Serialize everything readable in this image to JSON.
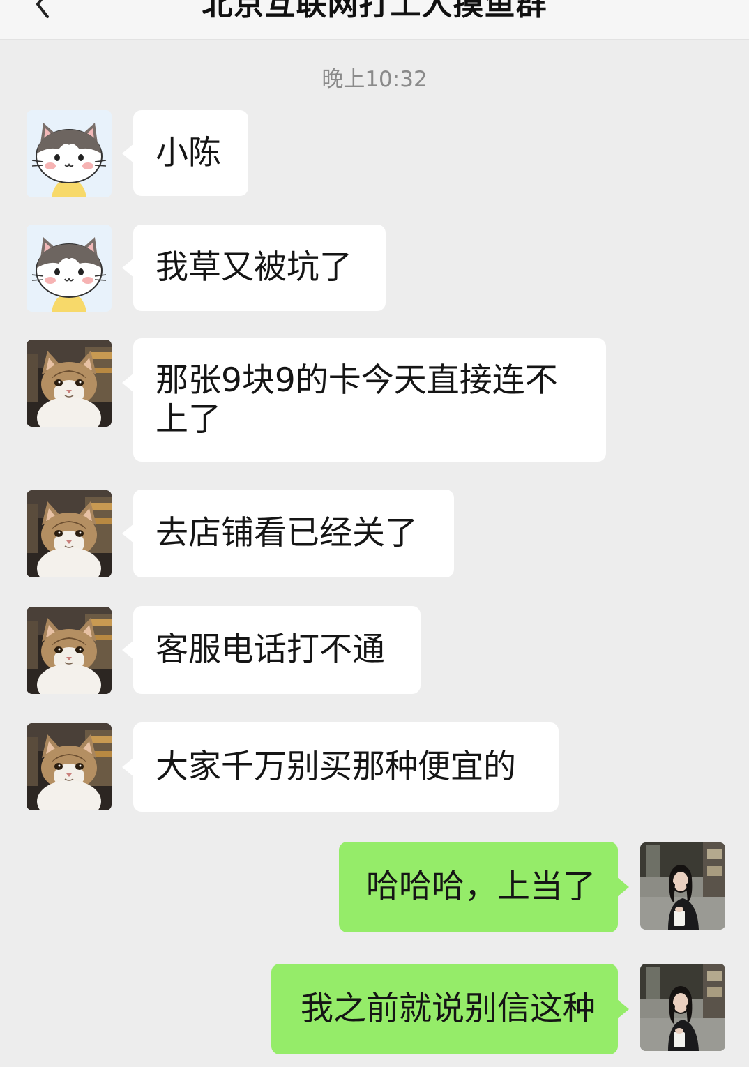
{
  "header": {
    "title": "北京互联网打工人摸鱼群",
    "back_icon": "chevron-left-icon"
  },
  "timestamp": "晚上10:32",
  "messages": [
    {
      "side": "left",
      "avatar": "cartoon-cat-avatar",
      "text": "小陈"
    },
    {
      "side": "left",
      "avatar": "cartoon-cat-avatar",
      "text": "我草又被坑了"
    },
    {
      "side": "left",
      "avatar": "photo-cat-avatar",
      "text": "那张9块9的卡今天直接连不上了"
    },
    {
      "side": "left",
      "avatar": "photo-cat-avatar",
      "text": "去店铺看已经关了"
    },
    {
      "side": "left",
      "avatar": "photo-cat-avatar",
      "text": "客服电话打不通"
    },
    {
      "side": "left",
      "avatar": "photo-cat-avatar",
      "text": "大家千万别买那种便宜的"
    },
    {
      "side": "right",
      "avatar": "photo-woman-avatar",
      "text": "哈哈哈，上当了"
    },
    {
      "side": "right",
      "avatar": "photo-woman-avatar",
      "text": "我之前就说别信这种"
    }
  ],
  "colors": {
    "background": "#ededed",
    "received_bubble": "#ffffff",
    "sent_bubble": "#95ec69",
    "timestamp_text": "#8a8a8a"
  }
}
